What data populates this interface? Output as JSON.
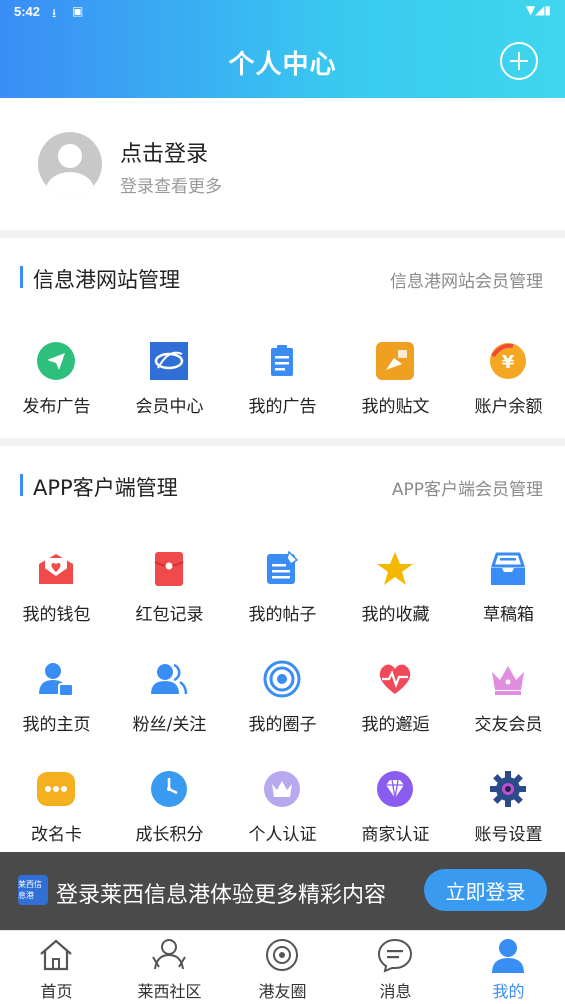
{
  "status_bar": {
    "time": "5:42"
  },
  "header": {
    "title": "个人中心"
  },
  "profile": {
    "login_text": "点击登录",
    "sub_text": "登录查看更多"
  },
  "section_web": {
    "title": "信息港网站管理",
    "link": "信息港网站会员管理",
    "items": [
      {
        "label": "发布广告",
        "icon": "send-icon",
        "color": "#2dbf7c"
      },
      {
        "label": "会员中心",
        "icon": "member-center-logo-icon",
        "color": "#2f6fd6"
      },
      {
        "label": "我的广告",
        "icon": "clipboard-icon",
        "color": "#3a8df5"
      },
      {
        "label": "我的贴文",
        "icon": "post-icon",
        "color": "#f0a020"
      },
      {
        "label": "账户余额",
        "icon": "yen-coin-icon",
        "color": "#f5a623"
      }
    ]
  },
  "section_app": {
    "title": "APP客户端管理",
    "link": "APP客户端会员管理",
    "items": [
      {
        "label": "我的钱包",
        "icon": "envelope-heart-icon",
        "color": "#f04a4a"
      },
      {
        "label": "红包记录",
        "icon": "red-packet-icon",
        "color": "#f04a4a"
      },
      {
        "label": "我的帖子",
        "icon": "edit-note-icon",
        "color": "#3a8df5"
      },
      {
        "label": "我的收藏",
        "icon": "star-icon",
        "color": "#f5b800"
      },
      {
        "label": "草稿箱",
        "icon": "inbox-tray-icon",
        "color": "#3a8df5"
      },
      {
        "label": "我的主页",
        "icon": "user-card-icon",
        "color": "#3a8df5"
      },
      {
        "label": "粉丝/关注",
        "icon": "users-icon",
        "color": "#3a8df5"
      },
      {
        "label": "我的圈子",
        "icon": "target-circle-icon",
        "color": "#3a8df5"
      },
      {
        "label": "我的邂逅",
        "icon": "heart-pulse-icon",
        "color": "#f04a5a"
      },
      {
        "label": "交友会员",
        "icon": "crown-icon",
        "color": "#e38de0"
      },
      {
        "label": "改名卡",
        "icon": "card-dots-icon",
        "color": "#f5b020"
      },
      {
        "label": "成长积分",
        "icon": "clock-icon",
        "color": "#3a9af0"
      },
      {
        "label": "个人认证",
        "icon": "crown-badge-icon",
        "color": "#b8a8f0"
      },
      {
        "label": "商家认证",
        "icon": "diamond-icon",
        "color": "#8b5cf0"
      },
      {
        "label": "账号设置",
        "icon": "gear-icon",
        "color": "#2a4a8a"
      }
    ]
  },
  "banner": {
    "text": "登录莱西信息港体验更多精彩内容",
    "button": "立即登录",
    "logo_text": "莱西信息港"
  },
  "tabbar": {
    "items": [
      {
        "label": "首页",
        "icon": "home-icon"
      },
      {
        "label": "莱西社区",
        "icon": "community-icon"
      },
      {
        "label": "港友圈",
        "icon": "planet-icon"
      },
      {
        "label": "消息",
        "icon": "message-icon"
      },
      {
        "label": "我的",
        "icon": "profile-icon",
        "active": true
      }
    ]
  }
}
